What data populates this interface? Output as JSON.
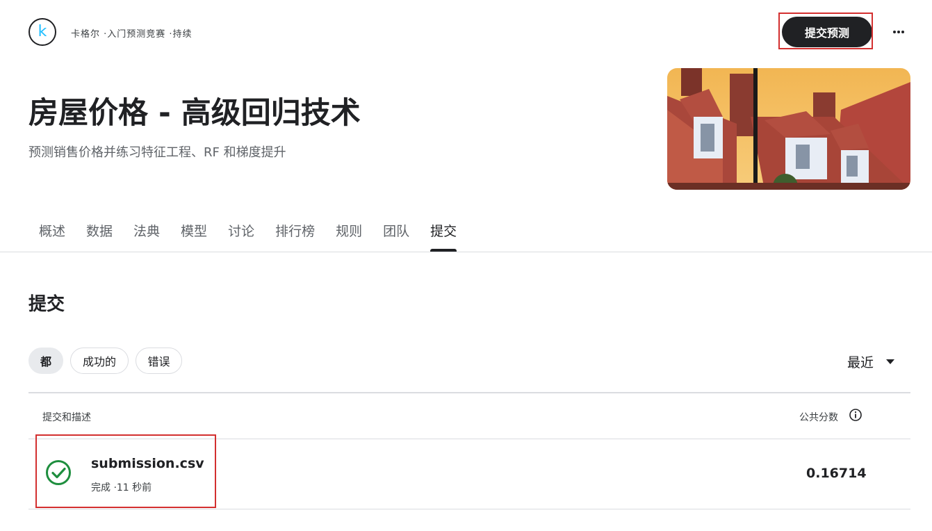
{
  "header": {
    "logo_letter": "k",
    "breadcrumb": "卡格尔 ·入门预测竞赛 ·持续",
    "submit_button_label": "提交预测"
  },
  "competition": {
    "title": "房屋价格 - 高级回归技术",
    "subtitle": "预测销售价格并练习特征工程、RF 和梯度提升"
  },
  "tabs": [
    {
      "label": "概述"
    },
    {
      "label": "数据"
    },
    {
      "label": "法典"
    },
    {
      "label": "模型"
    },
    {
      "label": "讨论"
    },
    {
      "label": "排行榜"
    },
    {
      "label": "规则"
    },
    {
      "label": "团队"
    },
    {
      "label": "提交",
      "active": true
    }
  ],
  "submissions": {
    "section_title": "提交",
    "filters": [
      "都",
      "成功的",
      "错误"
    ],
    "sort_label": "最近",
    "columns": {
      "description": "提交和描述",
      "score": "公共分数"
    },
    "rows": [
      {
        "file": "submission.csv",
        "meta": "完成 ·11 秒前",
        "score": "0.16714",
        "status": "success"
      }
    ]
  },
  "colors": {
    "primary_dark": "#202124",
    "kaggle_blue": "#20beff",
    "success_green": "#1e8e3e",
    "highlight_red": "#d32f2f"
  }
}
